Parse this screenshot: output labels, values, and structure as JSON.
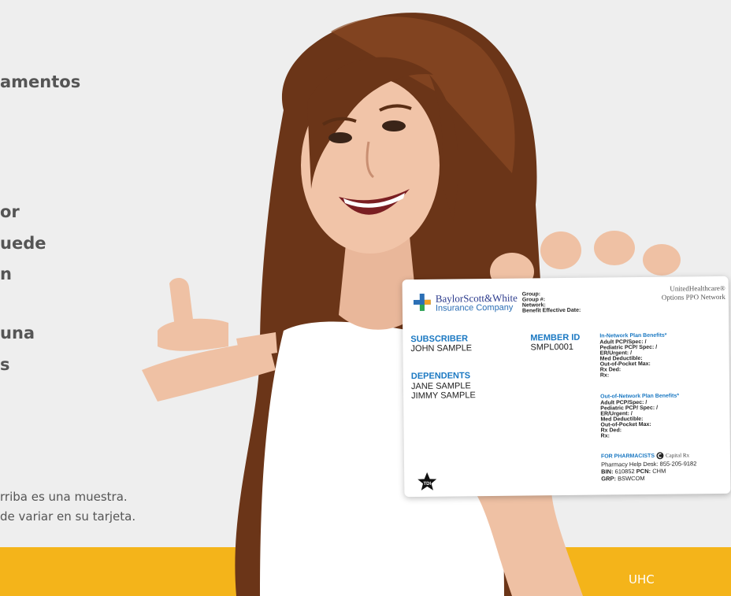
{
  "left_copy": {
    "heading_lines": [
      "amentos",
      "or",
      "uede",
      "n",
      "una",
      "s"
    ],
    "fineprint_lines": [
      "rriba es una muestra.",
      "de variar en su tarjeta."
    ]
  },
  "footer": {
    "tag": "UHC"
  },
  "card": {
    "company_name": "BaylorScott&White",
    "company_sub": "Insurance Company",
    "meta_labels": [
      "Group:",
      "Group #:",
      "Network:",
      "Benefit Effective Date:"
    ],
    "uhc_lines": [
      "UnitedHealthcare®",
      "Options PPO Network"
    ],
    "subscriber_label": "SUBSCRIBER",
    "subscriber_value": "JOHN SAMPLE",
    "member_id_label": "MEMBER ID",
    "member_id_value": "SMPL0001",
    "dependents_label": "DEPENDENTS",
    "dependents": [
      "JANE SAMPLE",
      "JIMMY SAMPLE"
    ],
    "in_network_title": "In-Network Plan Benefits*",
    "in_network_rows": [
      "Adult PCP/Spec: /",
      "Pediatric PCP/ Spec: /",
      "ER/Urgent: /",
      "Med Deductible:",
      "Out-of-Pocket Max:",
      "Rx Ded:",
      "Rx:"
    ],
    "out_network_title": "Out-of-Network Plan Benefits*",
    "out_network_rows": [
      "Adult PCP/Spec: /",
      "Pediatric PCP/ Spec: /",
      "ER/Urgent: /",
      "Med Deductible:",
      "Out-of-Pocket Max:",
      "Rx Ded:",
      "Rx:"
    ],
    "pharmacists_label": "FOR PHARMACISTS",
    "capital_rx": "Capital Rx",
    "help_desk": "Pharmacy Help Desk: 855-205-9182",
    "bin_label": "BIN:",
    "bin_value": "610852",
    "pcn_label": "PCN:",
    "pcn_value": "CHM",
    "grp_label": "GRP:",
    "grp_value": "BSWCOM",
    "tdi_text": "TDI"
  },
  "colors": {
    "footer": "#f4b41a",
    "card_blue": "#1a78c2",
    "text_gray": "#555555"
  }
}
